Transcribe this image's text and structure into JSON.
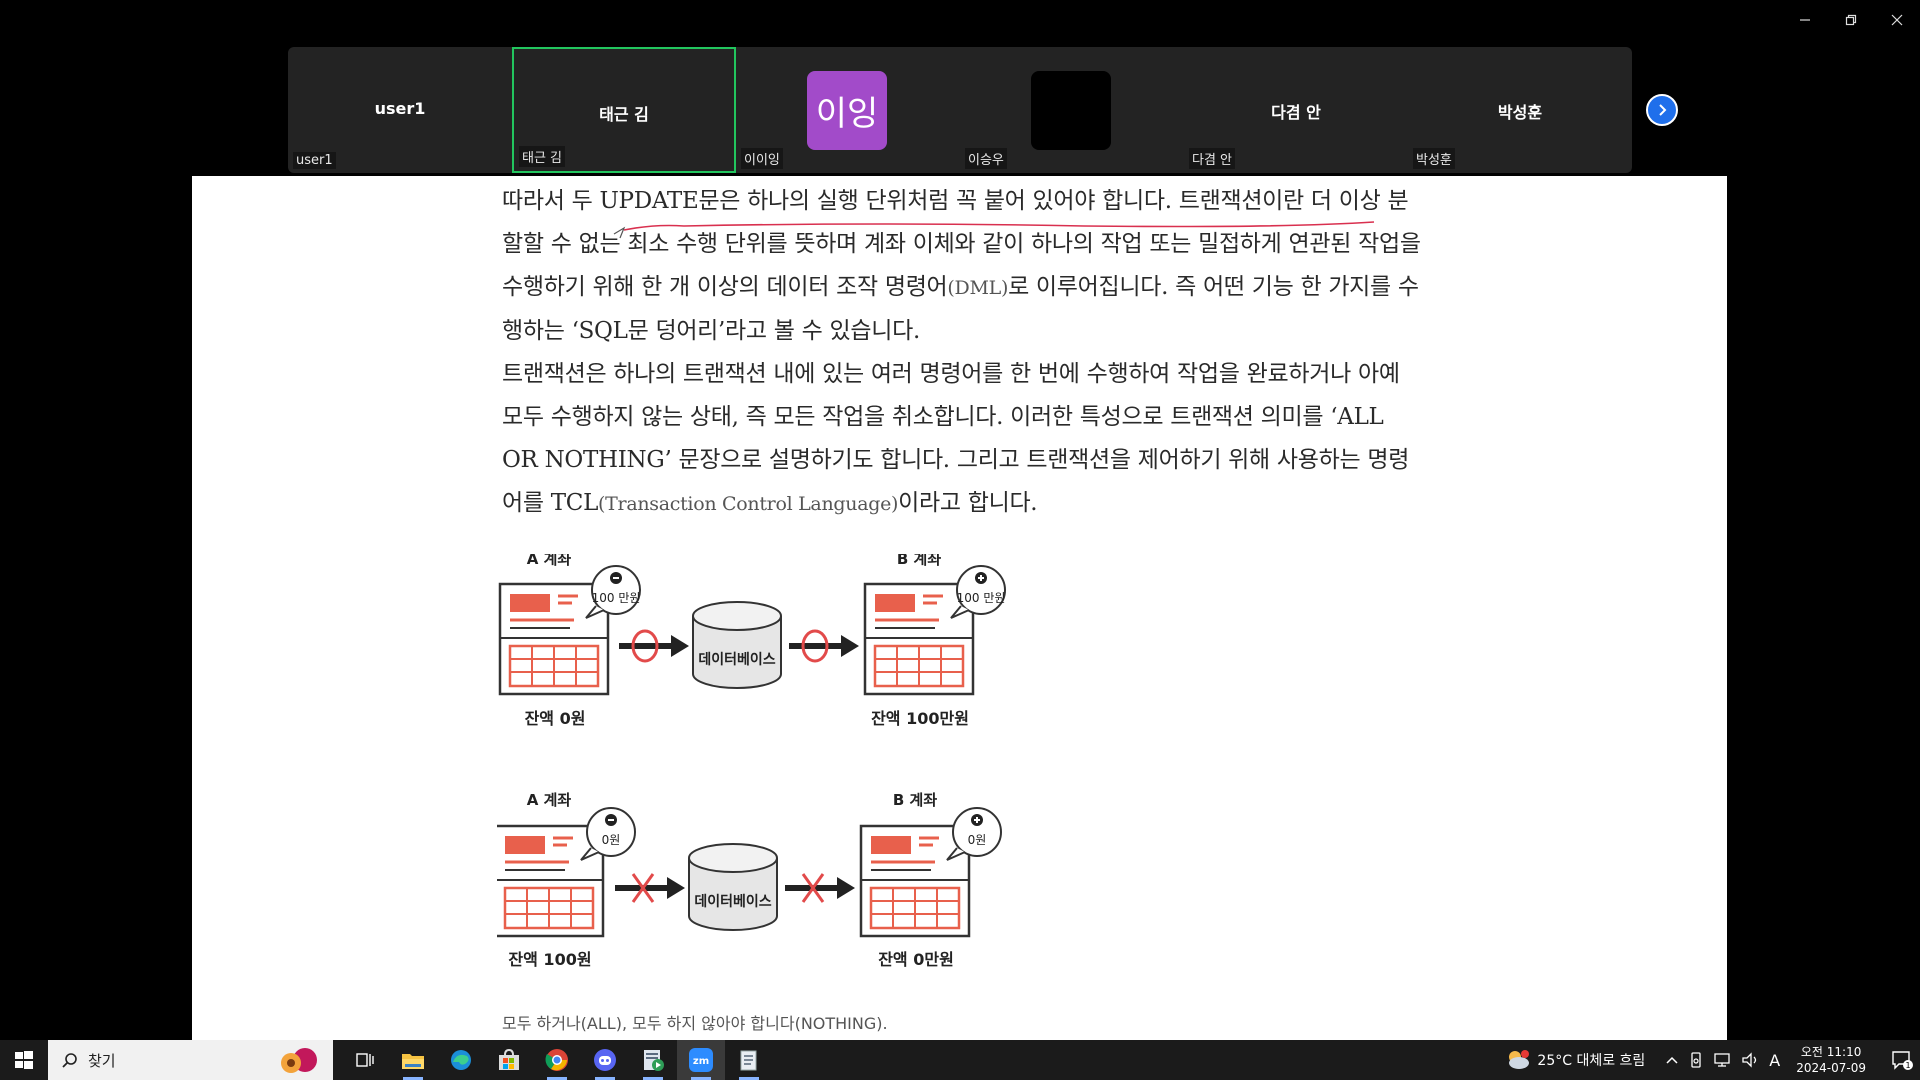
{
  "window": {
    "controls": [
      "minimize-icon",
      "restore-icon",
      "close-icon"
    ]
  },
  "participants": [
    {
      "name": "user1",
      "label": "user1"
    },
    {
      "name": "태근 김",
      "label": "태근 김"
    },
    {
      "avatar_text": "이잉",
      "avatar_color": "#a24bc9",
      "label": "이이잉"
    },
    {
      "avatar_color": "#000000",
      "label": "이승우"
    },
    {
      "name": "다겸 안",
      "label": "다겸 안"
    },
    {
      "name": "박성훈",
      "label": "박성훈"
    }
  ],
  "colors": {
    "active_border": "#22c55e",
    "diagram_accent": "#e8604c",
    "taskbar_bg": "#1b1b1b"
  },
  "document": {
    "para1": {
      "text": "따라서 두 UPDATE문은 하나의 실행 단위처럼 꼭 붙어 있어야 합니다. 트랜잭션이란 더 이상 분할할 수 없는 최소 수행 단위를 뜻하며 계좌 이체와 같이 하나의 작업 또는 밀접하게 연관된 작업을 수행하기 위해 한 개 이상의 데이터 조작 명령어",
      "sub": "(DML)",
      "rest": "로 이루어집니다. 즉 어떤 기능 한 가지를 수행하는 ‘SQL문 덩어리’라고 볼 수 있습니다."
    },
    "para2": {
      "text": "트랜잭션은 하나의 트랜잭션 내에 있는 여러 명령어를 한 번에 수행하여 작업을 완료하거나 아예 모두 수행하지 않는 상태, 즉 모든 작업을 취소합니다. 이러한 특성으로 트랜잭션 의미를 ‘ALL OR NOTHING’ 문장으로 설명하기도 합니다. 그리고 트랜잭션을 제어하기 위해 사용하는 명령어를 TCL",
      "sub": "(Transaction Control Language)",
      "rest": "이라고 합니다."
    },
    "diagram": {
      "row1": {
        "a_title": "A 계좌",
        "a_bubble": "100 만원",
        "a_balance": "잔액 0원",
        "db_label": "데이터베이스",
        "b_title": "B 계좌",
        "b_bubble": "100 만원",
        "b_balance": "잔액 100만원"
      },
      "row2": {
        "a_title": "A 계좌",
        "a_bubble": "0원",
        "a_balance": "잔액 100원",
        "db_label": "데이터베이스",
        "b_title": "B 계좌",
        "b_bubble": "0원",
        "b_balance": "잔액 0만원"
      }
    },
    "caption": "모두 하거나(ALL), 모두 하지 않아야 합니다(NOTHING)."
  },
  "taskbar": {
    "search_label": "찾기",
    "apps": [
      "task-view-icon",
      "file-explorer-icon",
      "edge-icon",
      "store-icon",
      "chrome-icon",
      "discord-icon",
      "media-app-icon",
      "zoom-icon",
      "notepad-icon"
    ],
    "weather": "25°C  대체로 흐림",
    "ime": "A",
    "time": "오전 11:10",
    "date": "2024-07-09",
    "notification_count": "1"
  }
}
